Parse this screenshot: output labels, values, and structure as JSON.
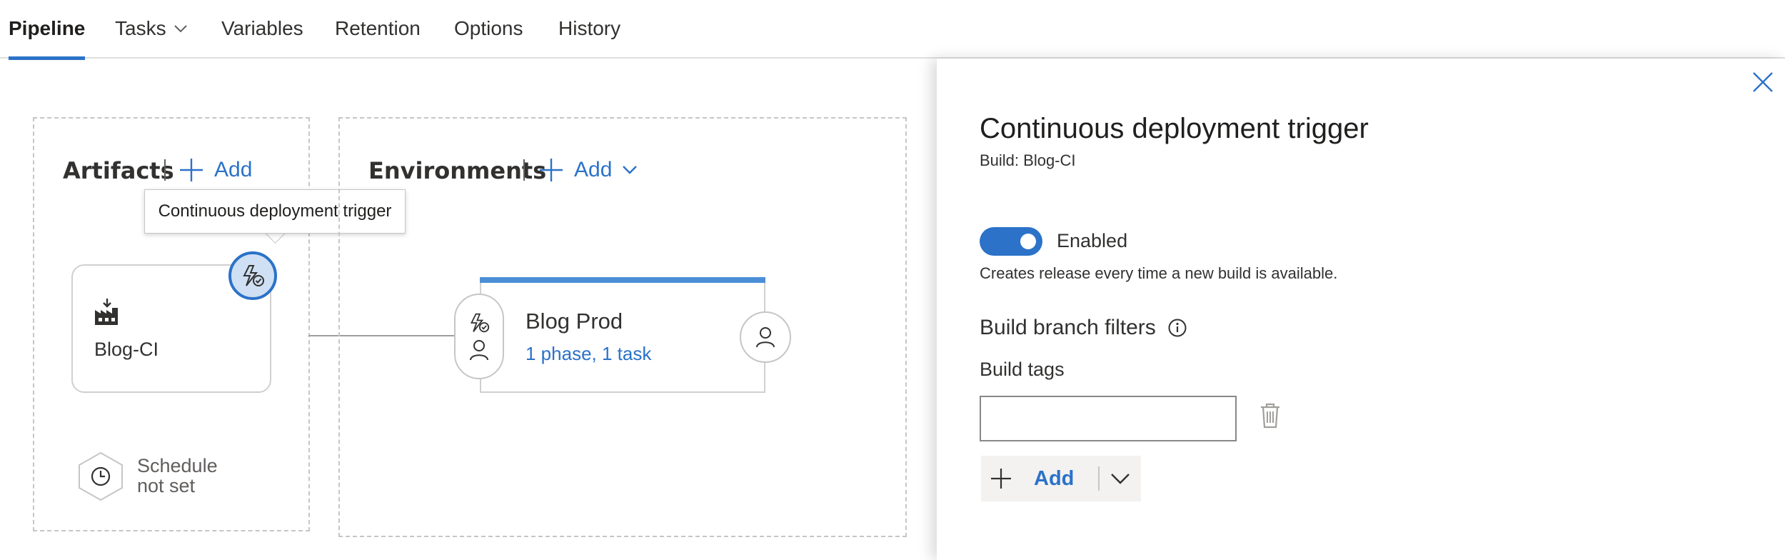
{
  "tabs": [
    {
      "label": "Pipeline"
    },
    {
      "label": "Tasks"
    },
    {
      "label": "Variables"
    },
    {
      "label": "Retention"
    },
    {
      "label": "Options"
    },
    {
      "label": "History"
    }
  ],
  "artifacts": {
    "title": "Artifacts",
    "add_label": "Add",
    "tooltip": "Continuous deployment trigger",
    "card_name": "Blog-CI",
    "schedule_line1": "Schedule",
    "schedule_line2": "not set"
  },
  "environments": {
    "title": "Environments",
    "add_label": "Add",
    "card_name": "Blog Prod",
    "card_sub": "1 phase, 1 task"
  },
  "panel": {
    "title": "Continuous deployment trigger",
    "subtitle": "Build: Blog-CI",
    "toggle_label": "Enabled",
    "description": "Creates release every time a new build is available.",
    "filters_title": "Build branch filters",
    "tags_label": "Build tags",
    "tags_value": "",
    "add_label": "Add"
  },
  "colors": {
    "accent": "#2b72c8",
    "border": "#c8c6c4"
  }
}
